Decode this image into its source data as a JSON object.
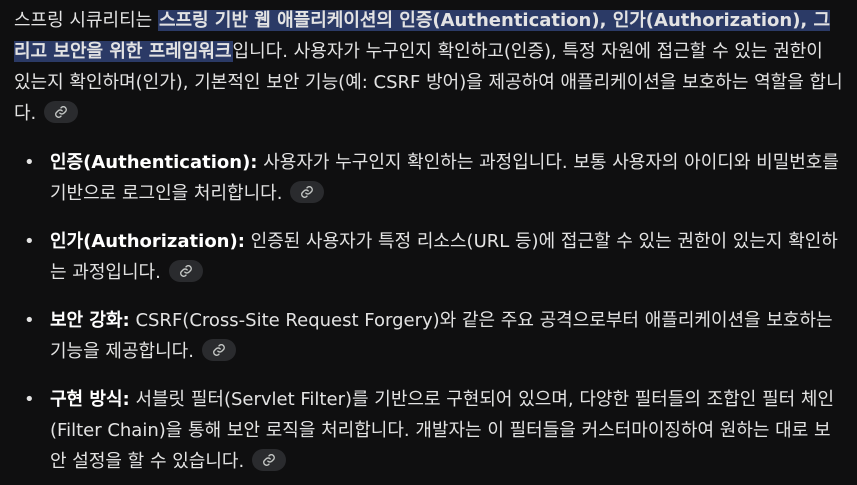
{
  "intro": {
    "lead": "스프링 시큐리티는 ",
    "highlight": "스프링 기반 웹 애플리케이션의 인증(Authentication), 인가(Authorization), 그리고 보안을 위한 프레임워크",
    "rest": "입니다. 사용자가 누구인지 확인하고(인증), 특정 자원에 접근할 수 있는 권한이 있는지 확인하며(인가), 기본적인 보안 기능(예: CSRF 방어)을 제공하여 애플리케이션을 보호하는 역할을 합니다."
  },
  "points": [
    {
      "term": "인증(Authentication):",
      "text": " 사용자가 누구인지 확인하는 과정입니다. 보통 사용자의 아이디와 비밀번호를 기반으로 로그인을 처리합니다."
    },
    {
      "term": "인가(Authorization):",
      "text": " 인증된 사용자가 특정 리소스(URL 등)에 접근할 수 있는 권한이 있는지 확인하는 과정입니다."
    },
    {
      "term": "보안 강화:",
      "text": " CSRF(Cross-Site Request Forgery)와 같은 주요 공격으로부터 애플리케이션을 보호하는 기능을 제공합니다."
    },
    {
      "term": "구현 방식:",
      "text": " 서블릿 필터(Servlet Filter)를 기반으로 구현되어 있으며, 다양한 필터들의 조합인 필터 체인(Filter Chain)을 통해 보안 로직을 처리합니다. 개발자는 이 필터들을 커스터마이징하여 원하는 대로 보안 설정을 할 수 있습니다."
    }
  ],
  "icons": {
    "source_link": "link-icon",
    "bullet": "•"
  },
  "colors": {
    "background": "#0f0f10",
    "text": "#e3e3e3",
    "highlight_bg": "#2b3a66",
    "chip_bg": "#2a2b2e"
  }
}
